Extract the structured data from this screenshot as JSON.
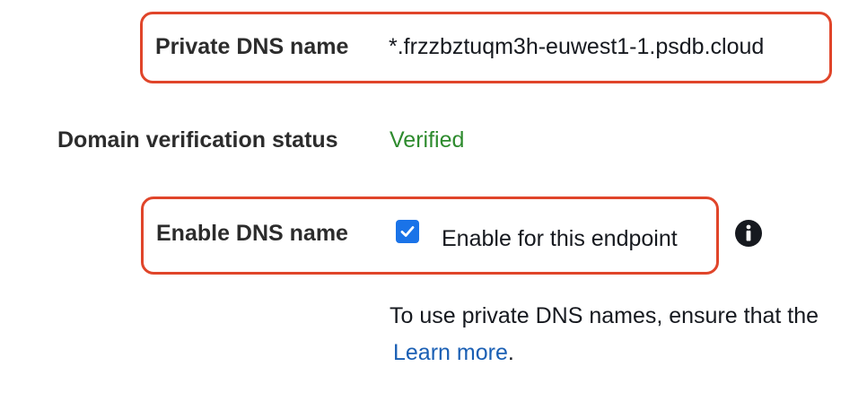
{
  "private_dns": {
    "label": "Private DNS name",
    "value": "*.frzzbztuqm3h-euwest1-1.psdb.cloud"
  },
  "domain_verification": {
    "label": "Domain verification status",
    "value": "Verified",
    "status_color": "#2e8b2e"
  },
  "enable_dns": {
    "label": "Enable DNS name",
    "checkbox_checked": true,
    "checkbox_label": "Enable for this endpoint",
    "info_icon": "info-circle-icon"
  },
  "help": {
    "text": "To use private DNS names, ensure that the",
    "learn_more_label": "Learn more",
    "trailing_period": "."
  },
  "colors": {
    "highlight_border": "#e0452a",
    "link": "#1a5fb4",
    "checkbox": "#1a73e8"
  }
}
